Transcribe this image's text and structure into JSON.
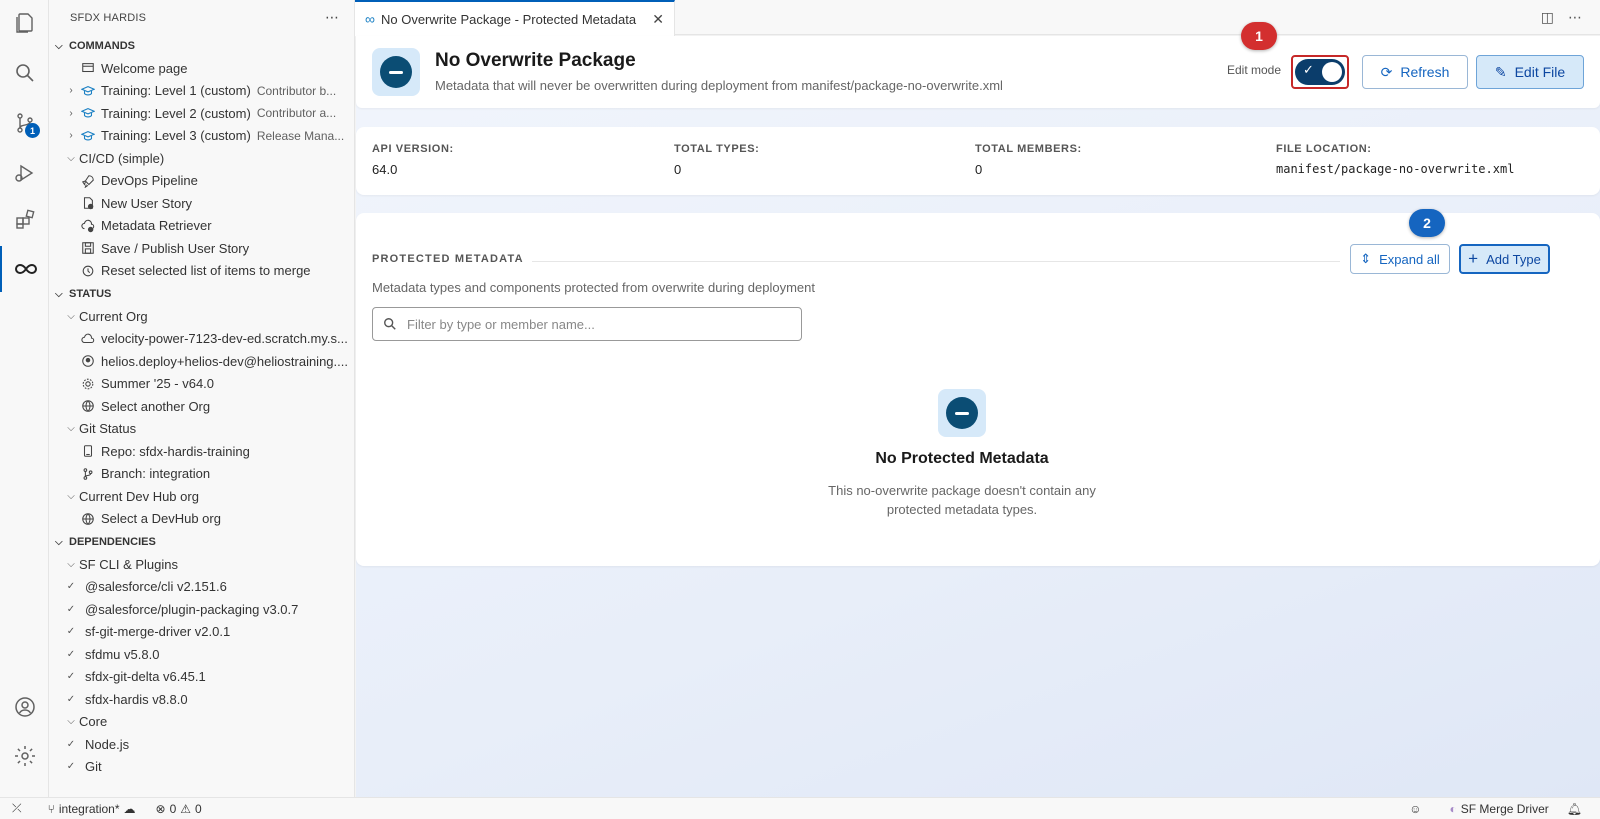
{
  "sidebar": {
    "title": "SFDX HARDIS",
    "commands_header": "COMMANDS",
    "commands": [
      {
        "label": "Welcome page",
        "desc": ""
      },
      {
        "label": "Training: Level 1 (custom)",
        "desc": "Contributor b..."
      },
      {
        "label": "Training: Level 2 (custom)",
        "desc": "Contributor a..."
      },
      {
        "label": "Training: Level 3 (custom)",
        "desc": "Release Mana..."
      },
      {
        "label": "CI/CD (simple)",
        "desc": ""
      },
      {
        "label": "DevOps Pipeline",
        "desc": ""
      },
      {
        "label": "New User Story",
        "desc": ""
      },
      {
        "label": "Metadata Retriever",
        "desc": ""
      },
      {
        "label": "Save / Publish User Story",
        "desc": ""
      },
      {
        "label": "Reset selected list of items to merge",
        "desc": ""
      }
    ],
    "status_header": "STATUS",
    "status": [
      {
        "label": "Current Org"
      },
      {
        "label": "velocity-power-7123-dev-ed.scratch.my.s..."
      },
      {
        "label": "helios.deploy+helios-dev@heliostraining...."
      },
      {
        "label": "Summer '25 - v64.0"
      },
      {
        "label": "Select another Org"
      },
      {
        "label": "Git Status"
      },
      {
        "label": "Repo: sfdx-hardis-training"
      },
      {
        "label": "Branch: integration"
      },
      {
        "label": "Current Dev Hub org"
      },
      {
        "label": "Select a DevHub org"
      }
    ],
    "deps_header": "DEPENDENCIES",
    "deps": [
      {
        "label": "SF CLI & Plugins"
      },
      {
        "label": "@salesforce/cli v2.151.6"
      },
      {
        "label": "@salesforce/plugin-packaging v3.0.7"
      },
      {
        "label": "sf-git-merge-driver v2.0.1"
      },
      {
        "label": "sfdmu v5.8.0"
      },
      {
        "label": "sfdx-git-delta v6.45.1"
      },
      {
        "label": "sfdx-hardis v8.8.0"
      },
      {
        "label": "Core"
      },
      {
        "label": "Node.js"
      },
      {
        "label": "Git"
      }
    ]
  },
  "activity": {
    "scm_badge": "1"
  },
  "tab": {
    "label": "No Overwrite Package - Protected Metadata"
  },
  "header": {
    "title": "No Overwrite Package",
    "subtitle": "Metadata that will never be overwritten during deployment from manifest/package-no-overwrite.xml",
    "edit_mode_label": "Edit mode",
    "edit_mode_on": true,
    "refresh_label": "Refresh",
    "edit_file_label": "Edit File"
  },
  "annotations": {
    "badge1": "1",
    "badge2": "2"
  },
  "info": {
    "api_version_label": "API VERSION:",
    "api_version": "64.0",
    "total_types_label": "TOTAL TYPES:",
    "total_types": "0",
    "total_members_label": "TOTAL MEMBERS:",
    "total_members": "0",
    "file_location_label": "FILE LOCATION:",
    "file_location": "manifest/package-no-overwrite.xml"
  },
  "protected": {
    "title": "PROTECTED METADATA",
    "expand_label": "Expand all",
    "add_label": "Add Type",
    "description": "Metadata types and components protected from overwrite during deployment",
    "filter_placeholder": "Filter by type or member name...",
    "empty_title": "No Protected Metadata",
    "empty_sub": "This no-overwrite package doesn't contain any protected metadata types."
  },
  "statusbar": {
    "branch": "integration*",
    "errors": "0",
    "warnings": "0",
    "merge_driver": "SF Merge Driver"
  },
  "colors": {
    "accent": "#005fb8",
    "brand_dark": "#0b4d74",
    "annotation_red": "#d32f2f",
    "annotation_blue": "#1565c0"
  }
}
